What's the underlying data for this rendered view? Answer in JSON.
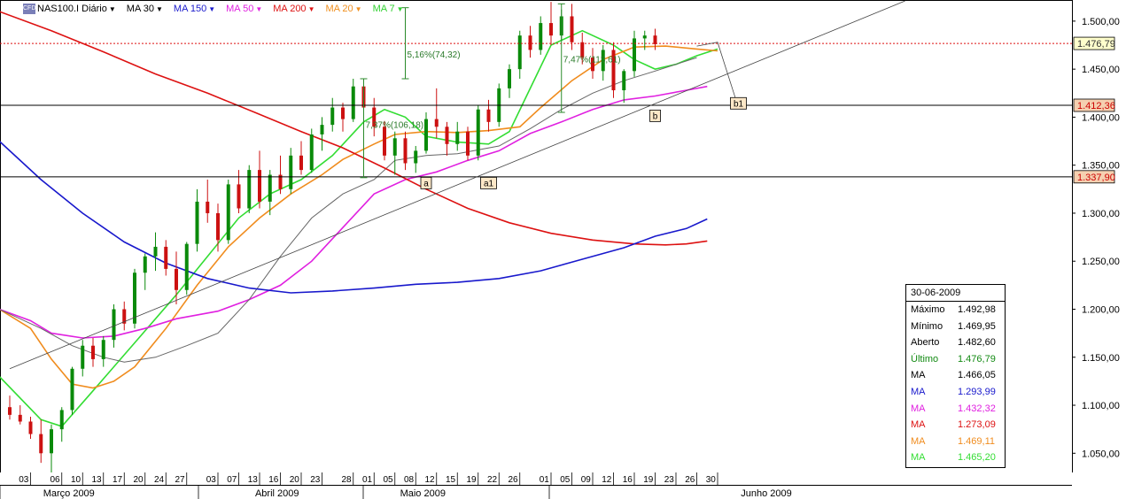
{
  "header": {
    "symbol": "NAS100.I Diário",
    "indicators": [
      {
        "label": "MA 30",
        "color": "#000000"
      },
      {
        "label": "MA 150",
        "color": "#1a1acc"
      },
      {
        "label": "MA 50",
        "color": "#e020e0"
      },
      {
        "label": "MA 200",
        "color": "#dd1111"
      },
      {
        "label": "MA 20",
        "color": "#f09020"
      },
      {
        "label": "MA 7",
        "color": "#30d030"
      }
    ]
  },
  "chart_data": {
    "type": "candlestick",
    "symbol": "NAS100.I",
    "period": "Diário",
    "ylim": [
      1030,
      1522
    ],
    "y_ticks": [
      "1.500,00",
      "1.450,00",
      "1.400,00",
      "1.350,00",
      "1.300,00",
      "1.250,00",
      "1.200,00",
      "1.150,00",
      "1.100,00",
      "1.050,00"
    ],
    "y_tick_values": [
      1500,
      1450,
      1400,
      1350,
      1300,
      1250,
      1200,
      1150,
      1100,
      1050
    ],
    "x_day_labels": [
      "03",
      "06",
      "10",
      "13",
      "17",
      "20",
      "24",
      "27",
      "03",
      "07",
      "13",
      "16",
      "20",
      "23",
      "28",
      "01",
      "05",
      "08",
      "12",
      "15",
      "19",
      "22",
      "26",
      "01",
      "05",
      "09",
      "12",
      "16",
      "19",
      "23",
      "26",
      "30"
    ],
    "x_day_index": [
      1,
      4,
      6,
      8,
      10,
      12,
      14,
      16,
      19,
      21,
      23,
      25,
      27,
      29,
      32,
      34,
      36,
      38,
      40,
      42,
      44,
      46,
      48,
      51,
      53,
      55,
      57,
      59,
      61,
      63,
      65,
      67
    ],
    "x_month_labels": [
      "Março 2009",
      "Abril 2009",
      "Maio 2009",
      "Junho 2009"
    ],
    "x_month_index": [
      5,
      25,
      39,
      72
    ],
    "candles": [
      [
        1098,
        1110,
        1085,
        1090
      ],
      [
        1090,
        1100,
        1080,
        1083
      ],
      [
        1083,
        1088,
        1065,
        1070
      ],
      [
        1070,
        1085,
        1040,
        1050
      ],
      [
        1050,
        1080,
        1030,
        1075
      ],
      [
        1075,
        1098,
        1062,
        1095
      ],
      [
        1095,
        1140,
        1090,
        1138
      ],
      [
        1138,
        1168,
        1130,
        1162
      ],
      [
        1162,
        1170,
        1140,
        1148
      ],
      [
        1148,
        1172,
        1140,
        1168
      ],
      [
        1168,
        1205,
        1160,
        1200
      ],
      [
        1200,
        1208,
        1178,
        1185
      ],
      [
        1185,
        1242,
        1180,
        1238
      ],
      [
        1238,
        1258,
        1220,
        1255
      ],
      [
        1255,
        1280,
        1240,
        1265
      ],
      [
        1265,
        1272,
        1235,
        1242
      ],
      [
        1242,
        1260,
        1205,
        1220
      ],
      [
        1220,
        1270,
        1215,
        1268
      ],
      [
        1268,
        1325,
        1260,
        1312
      ],
      [
        1312,
        1335,
        1290,
        1300
      ],
      [
        1300,
        1310,
        1260,
        1272
      ],
      [
        1272,
        1335,
        1268,
        1330
      ],
      [
        1330,
        1345,
        1300,
        1305
      ],
      [
        1305,
        1350,
        1300,
        1345
      ],
      [
        1345,
        1365,
        1305,
        1312
      ],
      [
        1312,
        1345,
        1298,
        1340
      ],
      [
        1340,
        1360,
        1320,
        1325
      ],
      [
        1325,
        1368,
        1320,
        1360
      ],
      [
        1360,
        1375,
        1340,
        1345
      ],
      [
        1345,
        1388,
        1342,
        1382
      ],
      [
        1382,
        1400,
        1365,
        1392
      ],
      [
        1392,
        1420,
        1385,
        1410
      ],
      [
        1410,
        1415,
        1385,
        1398
      ],
      [
        1398,
        1440,
        1395,
        1432
      ],
      [
        1432,
        1440,
        1398,
        1410
      ],
      [
        1410,
        1420,
        1380,
        1390
      ],
      [
        1390,
        1396,
        1355,
        1360
      ],
      [
        1360,
        1385,
        1340,
        1378
      ],
      [
        1378,
        1385,
        1345,
        1352
      ],
      [
        1352,
        1370,
        1342,
        1365
      ],
      [
        1365,
        1405,
        1362,
        1398
      ],
      [
        1398,
        1430,
        1378,
        1390
      ],
      [
        1390,
        1395,
        1360,
        1372
      ],
      [
        1372,
        1395,
        1365,
        1385
      ],
      [
        1385,
        1390,
        1355,
        1360
      ],
      [
        1360,
        1412,
        1355,
        1408
      ],
      [
        1408,
        1418,
        1385,
        1395
      ],
      [
        1395,
        1435,
        1390,
        1430
      ],
      [
        1430,
        1455,
        1420,
        1450
      ],
      [
        1450,
        1490,
        1440,
        1485
      ],
      [
        1485,
        1495,
        1462,
        1470
      ],
      [
        1470,
        1505,
        1465,
        1498
      ],
      [
        1498,
        1520,
        1475,
        1485
      ],
      [
        1485,
        1512,
        1480,
        1505
      ],
      [
        1505,
        1518,
        1470,
        1478
      ],
      [
        1478,
        1488,
        1455,
        1462
      ],
      [
        1462,
        1472,
        1440,
        1448
      ],
      [
        1448,
        1475,
        1438,
        1470
      ],
      [
        1470,
        1478,
        1420,
        1428
      ],
      [
        1428,
        1450,
        1415,
        1448
      ],
      [
        1448,
        1490,
        1442,
        1482
      ],
      [
        1482,
        1490,
        1470,
        1485
      ],
      [
        1485,
        1492,
        1470,
        1476
      ]
    ],
    "ma": [
      {
        "name": "MA 7",
        "color": "#33dd33",
        "width": 1.6,
        "points": [
          [
            -1,
            1130
          ],
          [
            3,
            1085
          ],
          [
            5,
            1078
          ],
          [
            8,
            1115
          ],
          [
            12,
            1165
          ],
          [
            16,
            1215
          ],
          [
            19,
            1255
          ],
          [
            22,
            1295
          ],
          [
            25,
            1320
          ],
          [
            28,
            1335
          ],
          [
            31,
            1360
          ],
          [
            34,
            1395
          ],
          [
            36,
            1408
          ],
          [
            38,
            1400
          ],
          [
            40,
            1380
          ],
          [
            43,
            1374
          ],
          [
            46,
            1372
          ],
          [
            48,
            1385
          ],
          [
            50,
            1430
          ],
          [
            52,
            1475
          ],
          [
            55,
            1490
          ],
          [
            58,
            1475
          ],
          [
            60,
            1460
          ],
          [
            62,
            1450
          ],
          [
            64,
            1455
          ],
          [
            66,
            1464
          ],
          [
            68,
            1471
          ]
        ]
      },
      {
        "name": "MA 20",
        "color": "#f08c1e",
        "width": 1.6,
        "points": [
          [
            -1,
            1200
          ],
          [
            2,
            1180
          ],
          [
            4,
            1148
          ],
          [
            6,
            1122
          ],
          [
            8,
            1118
          ],
          [
            10,
            1125
          ],
          [
            12,
            1140
          ],
          [
            15,
            1180
          ],
          [
            18,
            1225
          ],
          [
            21,
            1265
          ],
          [
            24,
            1295
          ],
          [
            27,
            1320
          ],
          [
            30,
            1340
          ],
          [
            32,
            1356
          ],
          [
            35,
            1372
          ],
          [
            37,
            1382
          ],
          [
            40,
            1385
          ],
          [
            43,
            1384
          ],
          [
            46,
            1386
          ],
          [
            49,
            1390
          ],
          [
            51,
            1410
          ],
          [
            54,
            1438
          ],
          [
            57,
            1460
          ],
          [
            60,
            1473
          ],
          [
            63,
            1474
          ],
          [
            66,
            1471
          ],
          [
            68,
            1469
          ]
        ]
      },
      {
        "name": "MA 50",
        "color": "#e020e0",
        "width": 1.6,
        "points": [
          [
            -1,
            1200
          ],
          [
            2,
            1188
          ],
          [
            4,
            1175
          ],
          [
            7,
            1170
          ],
          [
            10,
            1172
          ],
          [
            13,
            1180
          ],
          [
            16,
            1190
          ],
          [
            20,
            1198
          ],
          [
            23,
            1210
          ],
          [
            26,
            1225
          ],
          [
            29,
            1250
          ],
          [
            32,
            1285
          ],
          [
            35,
            1320
          ],
          [
            38,
            1335
          ],
          [
            41,
            1343
          ],
          [
            44,
            1355
          ],
          [
            47,
            1365
          ],
          [
            50,
            1383
          ],
          [
            53,
            1395
          ],
          [
            56,
            1408
          ],
          [
            59,
            1418
          ],
          [
            62,
            1422
          ],
          [
            65,
            1428
          ],
          [
            67,
            1432
          ]
        ]
      },
      {
        "name": "MA 30",
        "color": "#666666",
        "width": 1,
        "points": [
          [
            -1,
            1200
          ],
          [
            3,
            1180
          ],
          [
            6,
            1162
          ],
          [
            9,
            1150
          ],
          [
            11,
            1145
          ],
          [
            14,
            1150
          ],
          [
            17,
            1162
          ],
          [
            20,
            1175
          ],
          [
            23,
            1210
          ],
          [
            26,
            1255
          ],
          [
            29,
            1295
          ],
          [
            32,
            1320
          ],
          [
            35,
            1335
          ],
          [
            37,
            1355
          ],
          [
            40,
            1360
          ],
          [
            43,
            1362
          ],
          [
            47,
            1370
          ],
          [
            50,
            1388
          ],
          [
            53,
            1408
          ],
          [
            56,
            1425
          ],
          [
            59,
            1438
          ],
          [
            62,
            1448
          ],
          [
            64,
            1455
          ],
          [
            66,
            1462
          ]
        ]
      },
      {
        "name": "MA 200",
        "color": "#dd1111",
        "width": 1.6,
        "points": [
          [
            -1,
            1510
          ],
          [
            4,
            1490
          ],
          [
            9,
            1468
          ],
          [
            14,
            1445
          ],
          [
            19,
            1425
          ],
          [
            24,
            1403
          ],
          [
            28,
            1385
          ],
          [
            32,
            1368
          ],
          [
            36,
            1347
          ],
          [
            40,
            1325
          ],
          [
            44,
            1305
          ],
          [
            48,
            1290
          ],
          [
            52,
            1279
          ],
          [
            56,
            1272
          ],
          [
            60,
            1268
          ],
          [
            63,
            1267
          ],
          [
            65,
            1268
          ],
          [
            67,
            1271
          ]
        ]
      },
      {
        "name": "MA 150",
        "color": "#1818cc",
        "width": 1.6,
        "points": [
          [
            -1,
            1375
          ],
          [
            3,
            1335
          ],
          [
            7,
            1300
          ],
          [
            11,
            1270
          ],
          [
            15,
            1248
          ],
          [
            19,
            1232
          ],
          [
            23,
            1222
          ],
          [
            27,
            1217
          ],
          [
            31,
            1219
          ],
          [
            35,
            1222
          ],
          [
            39,
            1226
          ],
          [
            43,
            1228
          ],
          [
            47,
            1232
          ],
          [
            51,
            1240
          ],
          [
            55,
            1252
          ],
          [
            59,
            1264
          ],
          [
            62,
            1276
          ],
          [
            65,
            1284
          ],
          [
            67,
            1294
          ]
        ]
      }
    ],
    "horizontal_lines": [
      {
        "label": "1.476,79",
        "value": 1476.79,
        "style": "dotted",
        "color": "#dd1111",
        "label_bg": "#ffffcc",
        "label_color": "#333333"
      },
      {
        "label": "1.412,36",
        "value": 1412.36,
        "style": "solid",
        "color": "#000000",
        "label_bg": "#f5d0b0",
        "label_color": "#cc0000"
      },
      {
        "label": "1.337,90",
        "value": 1337.9,
        "style": "solid",
        "color": "#000000",
        "label_bg": "#f5d0b0",
        "label_color": "#cc0000"
      }
    ],
    "trendline": {
      "color": "#444444",
      "from": [
        0,
        1138
      ],
      "to": [
        86,
        1521
      ]
    },
    "measurements": [
      {
        "label": "5,16%(74,32)",
        "x": 38,
        "y_from": 1440,
        "y_to": 1514,
        "text_y": 1462
      },
      {
        "label": "7,37%(106,18)",
        "x": 34,
        "y_from": 1337,
        "y_to": 1440,
        "text_y": 1389
      },
      {
        "label": "7,47%(113,61)",
        "x": 53,
        "y_from": 1405,
        "y_to": 1518,
        "text_y": 1457
      }
    ],
    "wave_labels": [
      {
        "label": "a",
        "x": 40,
        "y": 1342
      },
      {
        "label": "a1",
        "x": 46,
        "y": 1342
      },
      {
        "label": "b",
        "x": 62,
        "y": 1412
      },
      {
        "label": "b1",
        "x": 70,
        "y": 1425
      }
    ],
    "projection": {
      "color": "#444444",
      "points": [
        [
          66,
          1474
        ],
        [
          68,
          1478
        ],
        [
          70,
          1410
        ]
      ]
    }
  },
  "info_box": {
    "date": "30-06-2009",
    "rows": [
      {
        "label": "Máximo",
        "value": "1.492,98",
        "color": "#000000"
      },
      {
        "label": "Mínimo",
        "value": "1.469,95",
        "color": "#000000"
      },
      {
        "label": "Aberto",
        "value": "1.482,60",
        "color": "#000000"
      },
      {
        "label": "Último",
        "value": "1.476,79",
        "color": "#138a13"
      },
      {
        "label": "MA",
        "value": "1.466,05",
        "color": "#000000"
      },
      {
        "label": "MA",
        "value": "1.293,99",
        "color": "#1818cc"
      },
      {
        "label": "MA",
        "value": "1.432,32",
        "color": "#e020e0"
      },
      {
        "label": "MA",
        "value": "1.273,09",
        "color": "#dd1111"
      },
      {
        "label": "MA",
        "value": "1.469,11",
        "color": "#f08c1e"
      },
      {
        "label": "MA",
        "value": "1.465,20",
        "color": "#33dd33"
      }
    ]
  }
}
